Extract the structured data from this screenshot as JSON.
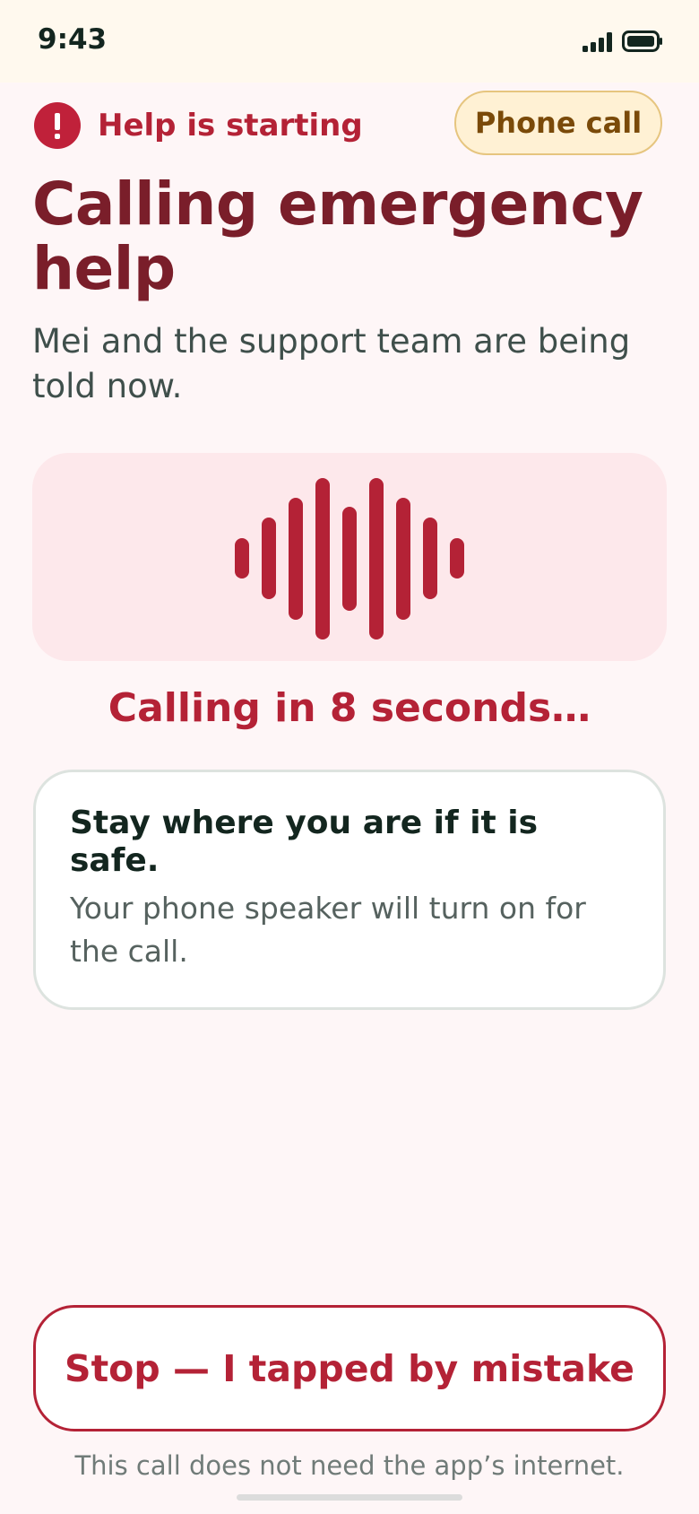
{
  "status_bar": {
    "time": "9:43",
    "icons": [
      "signal-icon",
      "battery-icon"
    ],
    "signal_bars": 4
  },
  "header": {
    "alert_icon": "exclamation-icon",
    "alert_label": "Help is starting",
    "phone_call_label": "Phone call"
  },
  "main": {
    "title": "Calling emergency help",
    "subtitle": "Mei and the support team are being told now.",
    "waveform_icon": "sound-wave-icon",
    "countdown": "Calling in 8 seconds…"
  },
  "info_card": {
    "heading": "Stay where you are if it is safe.",
    "body": "Your phone speaker will turn on for the call."
  },
  "footer": {
    "stop_label": "Stop — I tapped by mistake",
    "note": "This call does not need the app’s internet."
  },
  "colors": {
    "accent": "#b42236",
    "title": "#7a1e2a",
    "background": "#fef6f7",
    "panel": "#fde8eb",
    "call_pill": "#fff1d4",
    "status_bar": "#fff9ee"
  }
}
